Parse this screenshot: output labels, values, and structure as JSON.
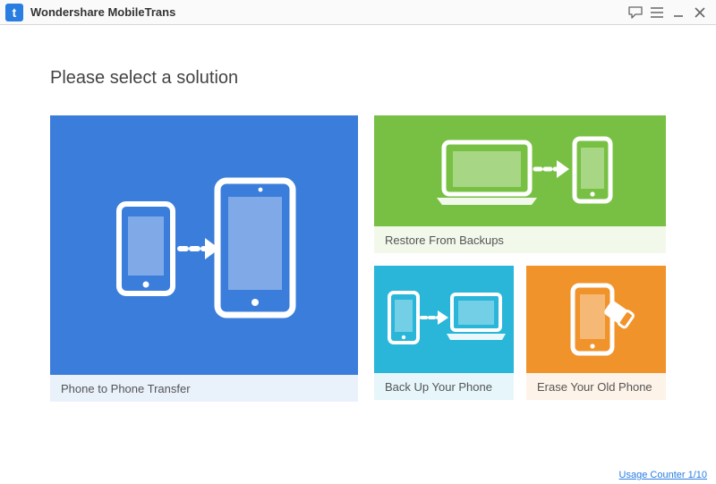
{
  "titlebar": {
    "logo_letter": "t",
    "app_name": "Wondershare MobileTrans"
  },
  "heading": "Please select a solution",
  "tiles": {
    "phone_transfer": {
      "label": "Phone to Phone Transfer"
    },
    "restore": {
      "label": "Restore From Backups"
    },
    "backup": {
      "label": "Back Up Your Phone"
    },
    "erase": {
      "label": "Erase Your Old Phone"
    }
  },
  "footer": {
    "usage_counter_label": "Usage Counter 1/10"
  },
  "colors": {
    "blue": "#3b7ddb",
    "green": "#78c043",
    "cyan": "#29b6d8",
    "orange": "#f0932b"
  }
}
